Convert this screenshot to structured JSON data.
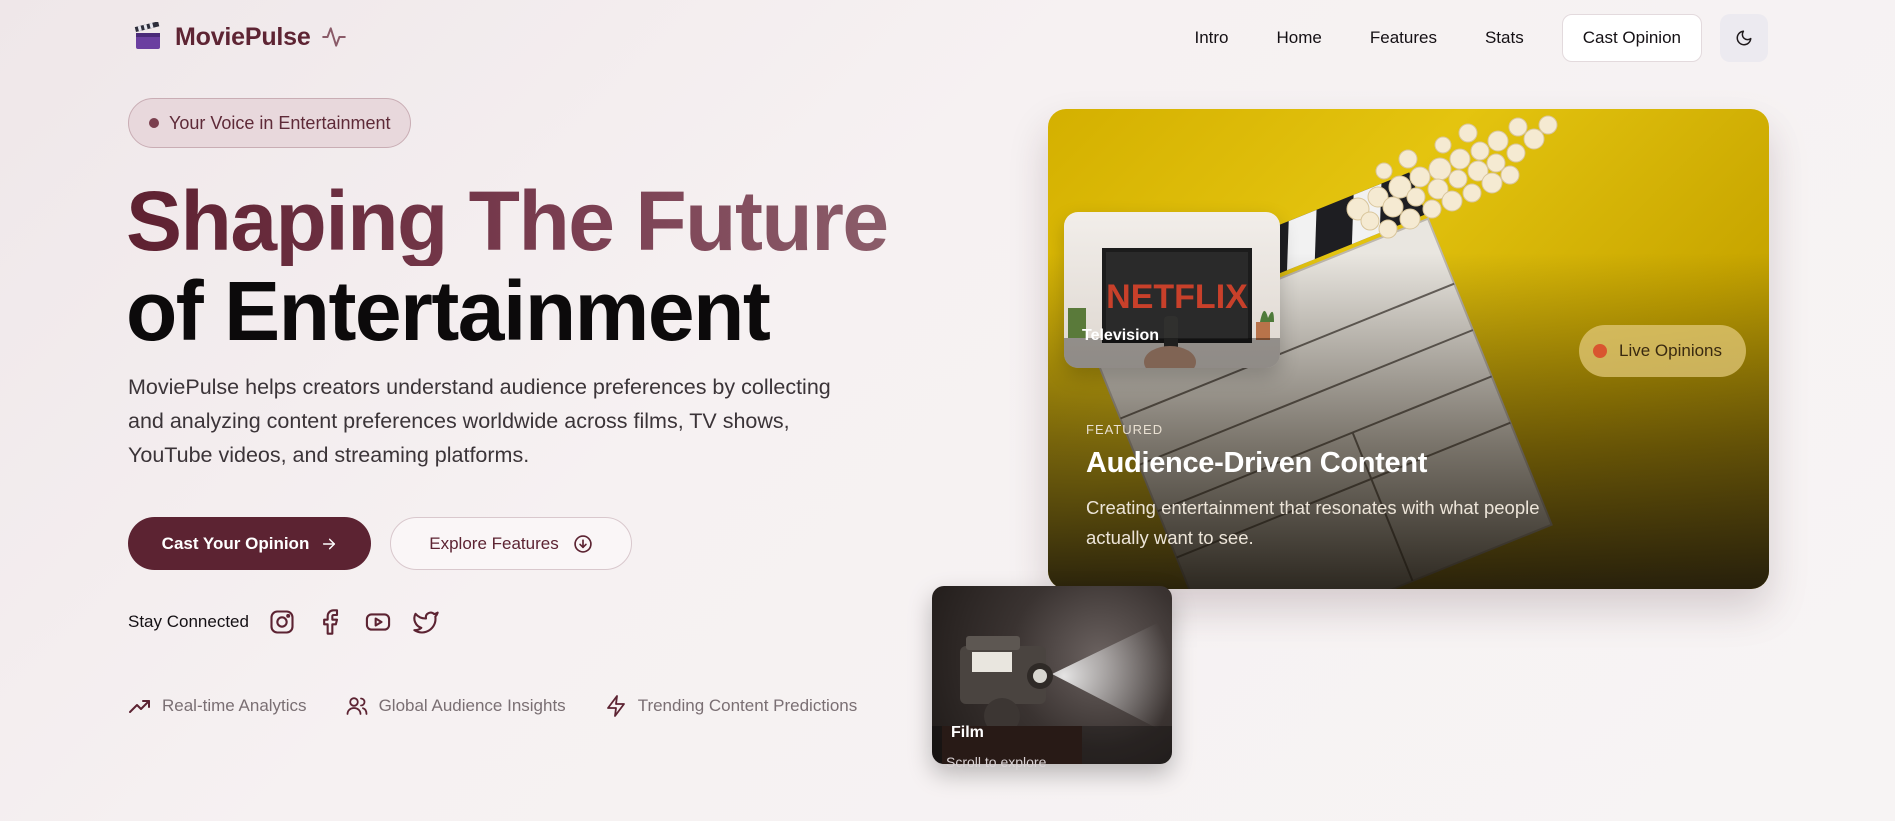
{
  "brand": {
    "name": "MoviePulse",
    "logo_icon": "clapperboard-icon",
    "pulse_icon": "activity-icon"
  },
  "nav": {
    "links": [
      "Intro",
      "Home",
      "Features",
      "Stats"
    ],
    "cta": "Cast Opinion",
    "theme_icon": "moon-icon"
  },
  "hero": {
    "badge": "Your Voice in Entertainment",
    "title_line1": "Shaping The Future",
    "title_line2": "of Entertainment",
    "lead": "MoviePulse helps creators understand audience preferences by collecting and analyzing content preferences worldwide across films, TV shows, YouTube videos, and streaming platforms.",
    "primary_button": "Cast Your Opinion",
    "secondary_button": "Explore Features",
    "social_label": "Stay Connected",
    "social_icons": [
      "instagram-icon",
      "facebook-icon",
      "youtube-icon",
      "twitter-icon"
    ],
    "features": [
      {
        "icon": "trending-up-icon",
        "label": "Real-time Analytics"
      },
      {
        "icon": "users-icon",
        "label": "Global Audience Insights"
      },
      {
        "icon": "zap-icon",
        "label": "Trending Content Predictions"
      }
    ]
  },
  "showcase": {
    "featured_label": "FEATURED",
    "featured_title": "Audience-Driven Content",
    "featured_desc": "Creating entertainment that resonates with what people actually want to see.",
    "live_badge": "Live Opinions",
    "tv_card_label": "Television",
    "tv_screen_text": "NETFLIX",
    "film_card_label": "Film",
    "scroll_hint": "Scroll to explore"
  },
  "colors": {
    "brand": "#5e2433",
    "primary_button": "#5c2332",
    "live_dot": "#d9552f",
    "featured_bg": "#d4b000"
  }
}
